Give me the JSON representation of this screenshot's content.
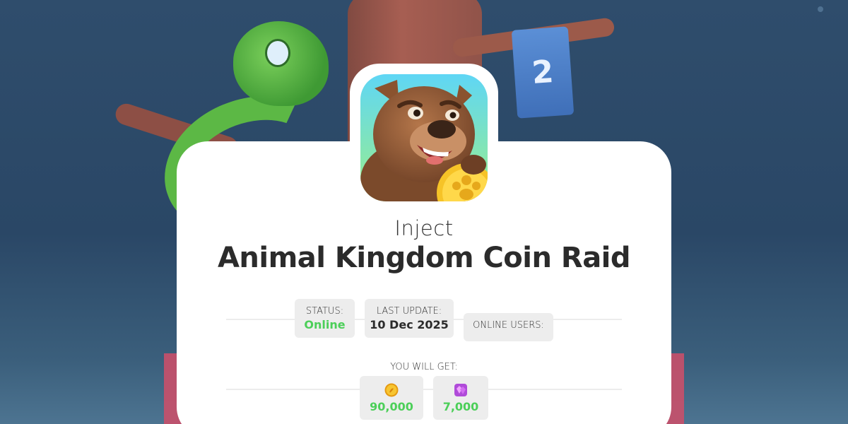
{
  "header": {
    "subtitle": "Inject",
    "title": "Animal Kingdom Coin Raid"
  },
  "background": {
    "flag_number": "2"
  },
  "status": {
    "status_label": "STATUS:",
    "status_value": "Online",
    "update_label": "LAST UPDATE:",
    "update_value": "10 Dec 2025",
    "online_label": "ONLINE USERS:"
  },
  "rewards": {
    "label": "YOU WILL GET:",
    "items": [
      {
        "icon": "coin-icon",
        "amount": "90,000"
      },
      {
        "icon": "gem-icon",
        "amount": "7,000"
      }
    ]
  },
  "colors": {
    "accent_green": "#4ccf59",
    "card_bg": "#ffffff",
    "pill_bg": "#ededed",
    "page_bg": "#2f4d6c"
  }
}
